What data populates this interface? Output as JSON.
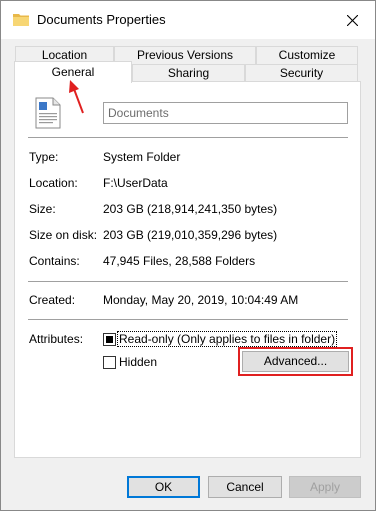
{
  "window": {
    "title": "Documents Properties"
  },
  "tabs": {
    "row1": [
      "Location",
      "Previous Versions",
      "Customize"
    ],
    "row2": [
      "General",
      "Sharing",
      "Security"
    ],
    "active": "General"
  },
  "general": {
    "folder_name": "Documents",
    "properties": [
      {
        "label": "Type:",
        "value": "System Folder"
      },
      {
        "label": "Location:",
        "value": "F:\\UserData"
      },
      {
        "label": "Size:",
        "value": "203 GB (218,914,241,350 bytes)"
      },
      {
        "label": "Size on disk:",
        "value": "203 GB (219,010,359,296 bytes)"
      },
      {
        "label": "Contains:",
        "value": "47,945 Files, 28,588 Folders"
      }
    ],
    "created": {
      "label": "Created:",
      "value": "Monday, May 20, 2019, 10:04:49 AM"
    },
    "attributes": {
      "label": "Attributes:",
      "readonly_label": "Read-only (Only applies to files in folder)",
      "readonly_state": "indeterminate",
      "hidden_label": "Hidden",
      "hidden_checked": false,
      "advanced_label": "Advanced..."
    }
  },
  "buttons": {
    "ok": "OK",
    "cancel": "Cancel",
    "apply": "Apply"
  },
  "colors": {
    "highlight": "#e02020",
    "focus_border": "#0078d7"
  }
}
